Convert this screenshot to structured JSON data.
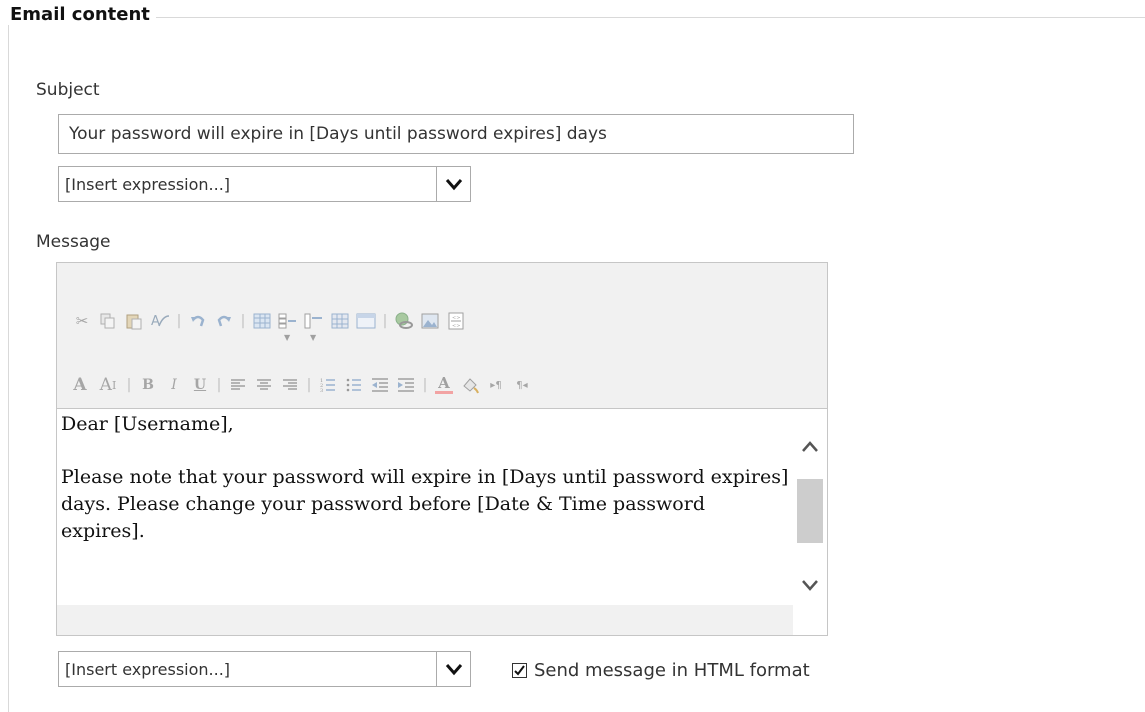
{
  "section": {
    "legend": "Email content"
  },
  "subject": {
    "label": "Subject",
    "value": "Your password will expire in [Days until password expires] days",
    "expression_select": "[Insert expression...]"
  },
  "message": {
    "label": "Message",
    "toolbar_row1": [
      "cut-icon",
      "copy-icon",
      "paste-icon",
      "spellcheck-icon",
      "undo-icon",
      "redo-icon",
      "insert-table-icon",
      "insert-row-icon",
      "insert-column-icon",
      "table-properties-icon",
      "cell-properties-icon",
      "insert-link-icon",
      "insert-image-icon",
      "source-icon"
    ],
    "toolbar_row2": [
      "font-icon",
      "font-size-icon",
      "bold-icon",
      "italic-icon",
      "underline-icon",
      "align-left-icon",
      "align-center-icon",
      "align-right-icon",
      "numbered-list-icon",
      "bullet-list-icon",
      "outdent-icon",
      "indent-icon",
      "text-color-icon",
      "highlight-icon",
      "ltr-icon",
      "rtl-icon"
    ],
    "body_line1": "Dear [Username],",
    "body_line2": "Please note that your password will expire in [Days until password expires] days. Please change your password before [Date & Time password expires].",
    "expression_select": "[Insert expression...]"
  },
  "html_format": {
    "label": "Send message in HTML format",
    "checked": true
  }
}
